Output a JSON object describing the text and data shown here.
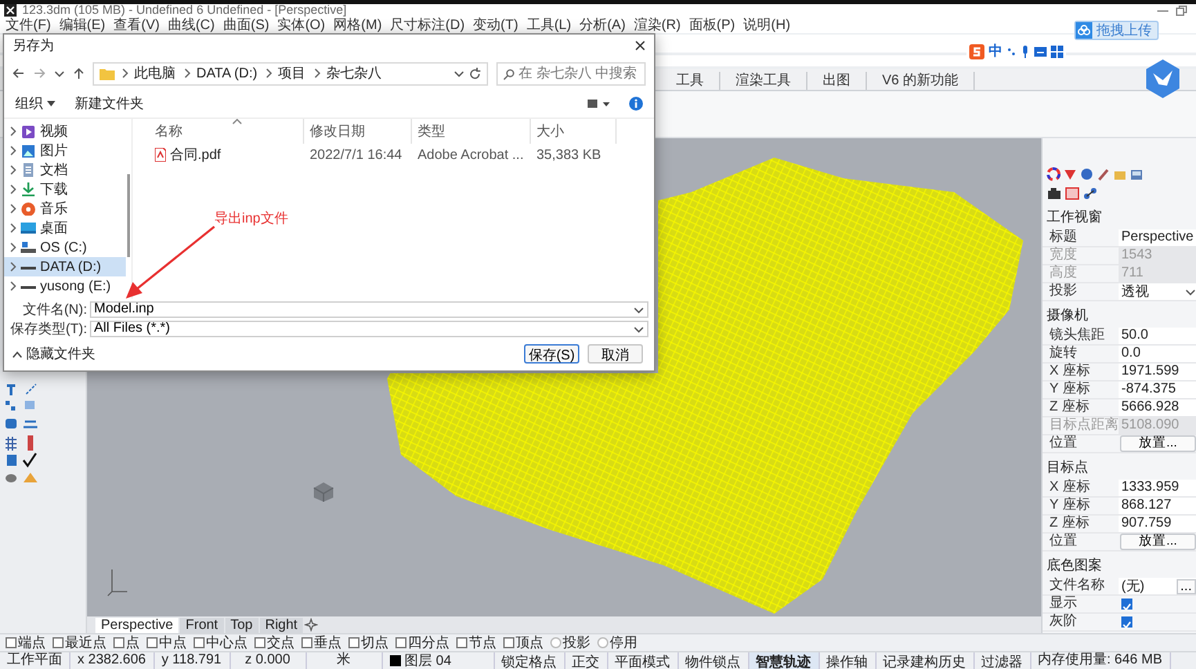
{
  "window": {
    "title": "123.3dm (105 MB) - Undefined 6 Undefined - [Perspective]"
  },
  "menu": [
    "文件(F)",
    "编辑(E)",
    "查看(V)",
    "曲线(C)",
    "曲面(S)",
    "实体(O)",
    "网格(M)",
    "尺寸标注(D)",
    "变动(T)",
    "工具(L)",
    "分析(A)",
    "渲染(R)",
    "面板(P)",
    "说明(H)"
  ],
  "upload_button": {
    "label": "拖拽上传"
  },
  "ime_toolbar": {
    "mode": "中"
  },
  "ribbon_tabs": [
    {
      "label": "工具",
      "selected": false
    },
    {
      "label": "渲染工具",
      "selected": false
    },
    {
      "label": "出图",
      "selected": false
    },
    {
      "label": "V6 的新功能",
      "selected": false
    }
  ],
  "viewport_tabs": [
    {
      "label": "Perspective",
      "selected": true
    },
    {
      "label": "Front",
      "selected": false
    },
    {
      "label": "Top",
      "selected": false
    },
    {
      "label": "Right",
      "selected": false
    }
  ],
  "properties": {
    "sections": [
      {
        "title": "工作视窗",
        "rows": [
          {
            "label": "标题",
            "value": "Perspective",
            "kind": "text"
          },
          {
            "label": "宽度",
            "value": "1543",
            "kind": "readonly"
          },
          {
            "label": "高度",
            "value": "711",
            "kind": "readonly"
          },
          {
            "label": "投影",
            "value": "透视",
            "kind": "dropdown"
          }
        ]
      },
      {
        "title": "摄像机",
        "rows": [
          {
            "label": "镜头焦距",
            "value": "50.0",
            "kind": "text"
          },
          {
            "label": "旋转",
            "value": "0.0",
            "kind": "text"
          },
          {
            "label": "X 座标",
            "value": "1971.599",
            "kind": "text"
          },
          {
            "label": "Y 座标",
            "value": "-874.375",
            "kind": "text"
          },
          {
            "label": "Z 座标",
            "value": "5666.928",
            "kind": "text"
          },
          {
            "label": "目标点距离",
            "value": "5108.090",
            "kind": "readonly"
          },
          {
            "label": "位置",
            "value": "放置...",
            "kind": "button"
          }
        ]
      },
      {
        "title": "目标点",
        "rows": [
          {
            "label": "X 座标",
            "value": "1333.959",
            "kind": "text"
          },
          {
            "label": "Y 座标",
            "value": "868.127",
            "kind": "text"
          },
          {
            "label": "Z 座标",
            "value": "907.759",
            "kind": "text"
          },
          {
            "label": "位置",
            "value": "放置...",
            "kind": "button"
          }
        ]
      },
      {
        "title": "底色图案",
        "rows": [
          {
            "label": "文件名称",
            "value": "(无)",
            "kind": "file",
            "browse": "..."
          },
          {
            "label": "显示",
            "kind": "checkbox",
            "checked": true
          },
          {
            "label": "灰阶",
            "kind": "checkbox",
            "checked": true
          }
        ]
      }
    ]
  },
  "osnaps": [
    {
      "label": "端点",
      "kind": "checkbox",
      "checked": false
    },
    {
      "label": "最近点",
      "kind": "checkbox",
      "checked": false
    },
    {
      "label": "点",
      "kind": "checkbox",
      "checked": false
    },
    {
      "label": "中点",
      "kind": "checkbox",
      "checked": false
    },
    {
      "label": "中心点",
      "kind": "checkbox",
      "checked": false
    },
    {
      "label": "交点",
      "kind": "checkbox",
      "checked": false
    },
    {
      "label": "垂点",
      "kind": "checkbox",
      "checked": false
    },
    {
      "label": "切点",
      "kind": "checkbox",
      "checked": false
    },
    {
      "label": "四分点",
      "kind": "checkbox",
      "checked": false
    },
    {
      "label": "节点",
      "kind": "checkbox",
      "checked": false
    },
    {
      "label": "顶点",
      "kind": "checkbox",
      "checked": false
    },
    {
      "label": "投影",
      "kind": "radio",
      "checked": false
    },
    {
      "label": "停用",
      "kind": "radio",
      "checked": false
    }
  ],
  "status_bar": {
    "cells": [
      "工作平面",
      "x 2382.606",
      "y 118.791",
      "z 0.000",
      "米"
    ],
    "layer": {
      "name": "图层 04",
      "color": "#000000"
    },
    "toggles": [
      {
        "label": "锁定格点",
        "on": false
      },
      {
        "label": "正交",
        "on": false
      },
      {
        "label": "平面模式",
        "on": false
      },
      {
        "label": "物件锁点",
        "on": false
      },
      {
        "label": "智慧轨迹",
        "on": true
      },
      {
        "label": "操作轴",
        "on": false
      },
      {
        "label": "记录建构历史",
        "on": false
      },
      {
        "label": "过滤器",
        "on": false
      }
    ],
    "memory": "内存使用量: 646 MB"
  },
  "dialog": {
    "title": "另存为",
    "path": [
      "此电脑",
      "DATA (D:)",
      "项目",
      "杂七杂八"
    ],
    "search": {
      "placeholder": "在 杂七杂八 中搜索"
    },
    "organize": "组织",
    "new_folder": "新建文件夹",
    "tree": [
      {
        "label": "视频",
        "kind": "video",
        "selected": false
      },
      {
        "label": "图片",
        "kind": "pictures",
        "selected": false
      },
      {
        "label": "文档",
        "kind": "documents",
        "selected": false
      },
      {
        "label": "下载",
        "kind": "downloads",
        "selected": false
      },
      {
        "label": "音乐",
        "kind": "music",
        "selected": false
      },
      {
        "label": "桌面",
        "kind": "desktop",
        "selected": false
      },
      {
        "label": "OS (C:)",
        "kind": "system-drive",
        "selected": false
      },
      {
        "label": "DATA (D:)",
        "kind": "drive",
        "selected": true
      },
      {
        "label": "yusong (E:)",
        "kind": "drive",
        "selected": false
      }
    ],
    "columns": [
      "名称",
      "修改日期",
      "类型",
      "大小"
    ],
    "files": [
      {
        "name": "合同.pdf",
        "modified": "2022/7/1 16:44",
        "type": "Adobe Acrobat ...",
        "size": "35,383 KB"
      }
    ],
    "fields": [
      {
        "label": "文件名(N):",
        "value": "Model.inp"
      },
      {
        "label": "保存类型(T):",
        "value": "All Files (*.*)"
      }
    ],
    "hide_folders": "隐藏文件夹",
    "buttons": [
      {
        "label": "保存(S)",
        "kind": "primary"
      },
      {
        "label": "取消",
        "kind": "normal"
      }
    ],
    "annotation": "导出inp文件"
  }
}
